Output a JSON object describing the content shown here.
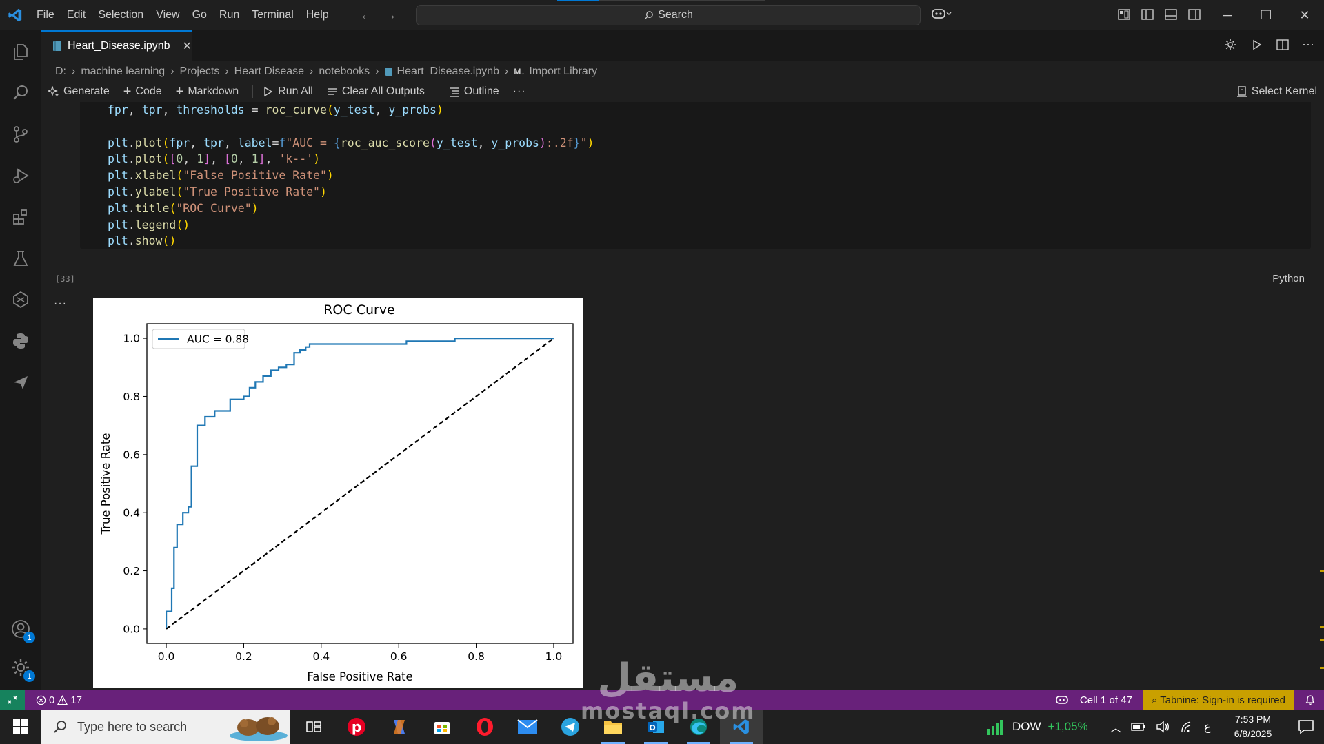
{
  "titlebar": {
    "menu": [
      "File",
      "Edit",
      "Selection",
      "View",
      "Go",
      "Run",
      "Terminal",
      "Help"
    ],
    "search_label": "Search"
  },
  "tab": {
    "name": "Heart_Disease.ipynb",
    "close": "✕"
  },
  "breadcrumb": [
    "D:",
    "machine learning",
    "Projects",
    "Heart Disease",
    "notebooks",
    "Heart_Disease.ipynb",
    "Import Library"
  ],
  "breadcrumb_md_badge": "M↓",
  "toolbar": {
    "generate": "Generate",
    "code": "Code",
    "markdown": "Markdown",
    "run_all": "Run All",
    "clear_outputs": "Clear All Outputs",
    "outline": "Outline",
    "more": "···",
    "select_kernel": "Select Kernel"
  },
  "cell": {
    "execution_count": "[33]",
    "language": "Python",
    "output_more": "···",
    "code_lines": [
      "fpr, tpr, thresholds = roc_curve(y_test, y_probs)",
      "",
      "plt.plot(fpr, tpr, label=f\"AUC = {roc_auc_score(y_test, y_probs):.2f}\")",
      "plt.plot([0, 1], [0, 1], 'k--')",
      "plt.xlabel(\"False Positive Rate\")",
      "plt.ylabel(\"True Positive Rate\")",
      "plt.title(\"ROC Curve\")",
      "plt.legend()",
      "plt.show()"
    ]
  },
  "chart_data": {
    "type": "line",
    "title": "ROC Curve",
    "xlabel": "False Positive Rate",
    "ylabel": "True Positive Rate",
    "xlim": [
      -0.05,
      1.05
    ],
    "ylim": [
      -0.05,
      1.05
    ],
    "xticks": [
      "0.0",
      "0.2",
      "0.4",
      "0.6",
      "0.8",
      "1.0"
    ],
    "yticks": [
      "0.0",
      "0.2",
      "0.4",
      "0.6",
      "0.8",
      "1.0"
    ],
    "legend_position": "top-left",
    "grid": false,
    "series": [
      {
        "name": "AUC = 0.88",
        "color": "#1f77b4",
        "style": "step",
        "x": [
          0.0,
          0.0,
          0.0,
          0.0,
          0.014,
          0.014,
          0.02,
          0.02,
          0.028,
          0.028,
          0.043,
          0.043,
          0.057,
          0.057,
          0.065,
          0.065,
          0.08,
          0.08,
          0.1,
          0.1,
          0.125,
          0.125,
          0.165,
          0.165,
          0.2,
          0.2,
          0.215,
          0.215,
          0.23,
          0.23,
          0.25,
          0.25,
          0.27,
          0.27,
          0.29,
          0.29,
          0.31,
          0.31,
          0.33,
          0.33,
          0.345,
          0.345,
          0.36,
          0.36,
          0.37,
          0.37,
          0.4,
          0.4,
          0.62,
          0.62,
          0.745,
          0.745,
          1.0
        ],
        "y": [
          0.0,
          0.03,
          0.03,
          0.06,
          0.06,
          0.14,
          0.14,
          0.28,
          0.28,
          0.36,
          0.36,
          0.4,
          0.4,
          0.42,
          0.42,
          0.56,
          0.56,
          0.7,
          0.7,
          0.73,
          0.73,
          0.75,
          0.75,
          0.79,
          0.79,
          0.8,
          0.8,
          0.83,
          0.83,
          0.85,
          0.85,
          0.87,
          0.87,
          0.89,
          0.89,
          0.9,
          0.9,
          0.91,
          0.91,
          0.95,
          0.95,
          0.96,
          0.96,
          0.97,
          0.97,
          0.98,
          0.98,
          0.98,
          0.98,
          0.99,
          0.99,
          1.0,
          1.0
        ]
      },
      {
        "name": "",
        "color": "#000000",
        "style": "dashed",
        "x": [
          0,
          1
        ],
        "y": [
          0,
          1
        ]
      }
    ]
  },
  "statusbar": {
    "errors": "0",
    "warnings": "17",
    "cell_position": "Cell 1 of 47",
    "tabnine": "Tabnine: Sign-in is required"
  },
  "taskbar": {
    "search_placeholder": "Type here to search",
    "stock_name": "DOW",
    "stock_change": "+1,05%",
    "lang": "ع",
    "time": "7:53 PM",
    "date": "6/8/2025"
  },
  "badges": {
    "accounts": "1",
    "settings": "1"
  },
  "watermark": {
    "arabic": "مستقل",
    "latin": "mostaql.com"
  },
  "colors": {
    "statusbar": "#68217a",
    "accent": "#0078d4",
    "tabnine": "#c9a000",
    "series": "#1f77b4"
  }
}
